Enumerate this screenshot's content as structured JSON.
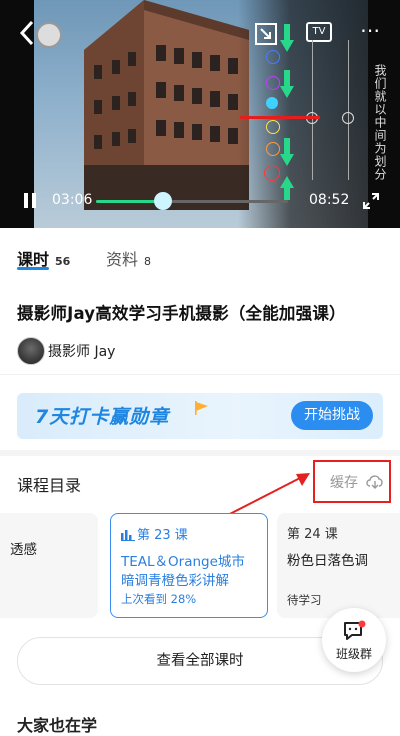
{
  "video": {
    "current_time": "03:06",
    "total_time": "08:52",
    "progress": 0.35,
    "side_text": "我们就以中间为划分",
    "overlay_marks": [
      "蓝",
      "红",
      "紫",
      "绿",
      "紫",
      "红",
      "橙",
      "黄"
    ],
    "tv_label": "TV",
    "accent": "#28d88a"
  },
  "tabs": [
    {
      "label": "课时",
      "count": "56",
      "active": true
    },
    {
      "label": "资料",
      "count": "8",
      "active": false
    }
  ],
  "course": {
    "title": "摄影师Jay高效学习手机摄影（全能加强课）",
    "author": "摄影师 Jay"
  },
  "banner": {
    "text": "7天打卡赢勋章",
    "button": "开始挑战",
    "accent": "#2b8df0"
  },
  "catalog": {
    "title": "课程目录",
    "cache_label": "缓存",
    "lessons": [
      {
        "num": "",
        "name": "透感",
        "status": ""
      },
      {
        "num": "第 23 课",
        "name": "TEAL＆Orange城市暗调青橙色彩讲解",
        "status": "上次看到 28%",
        "active": true
      },
      {
        "num": "第 24 课",
        "name": "粉色日落色调",
        "status": "待学习"
      }
    ],
    "view_all": "查看全部课时"
  },
  "class_group": {
    "label": "班级群"
  },
  "next_section": {
    "title": "大家也在学"
  }
}
